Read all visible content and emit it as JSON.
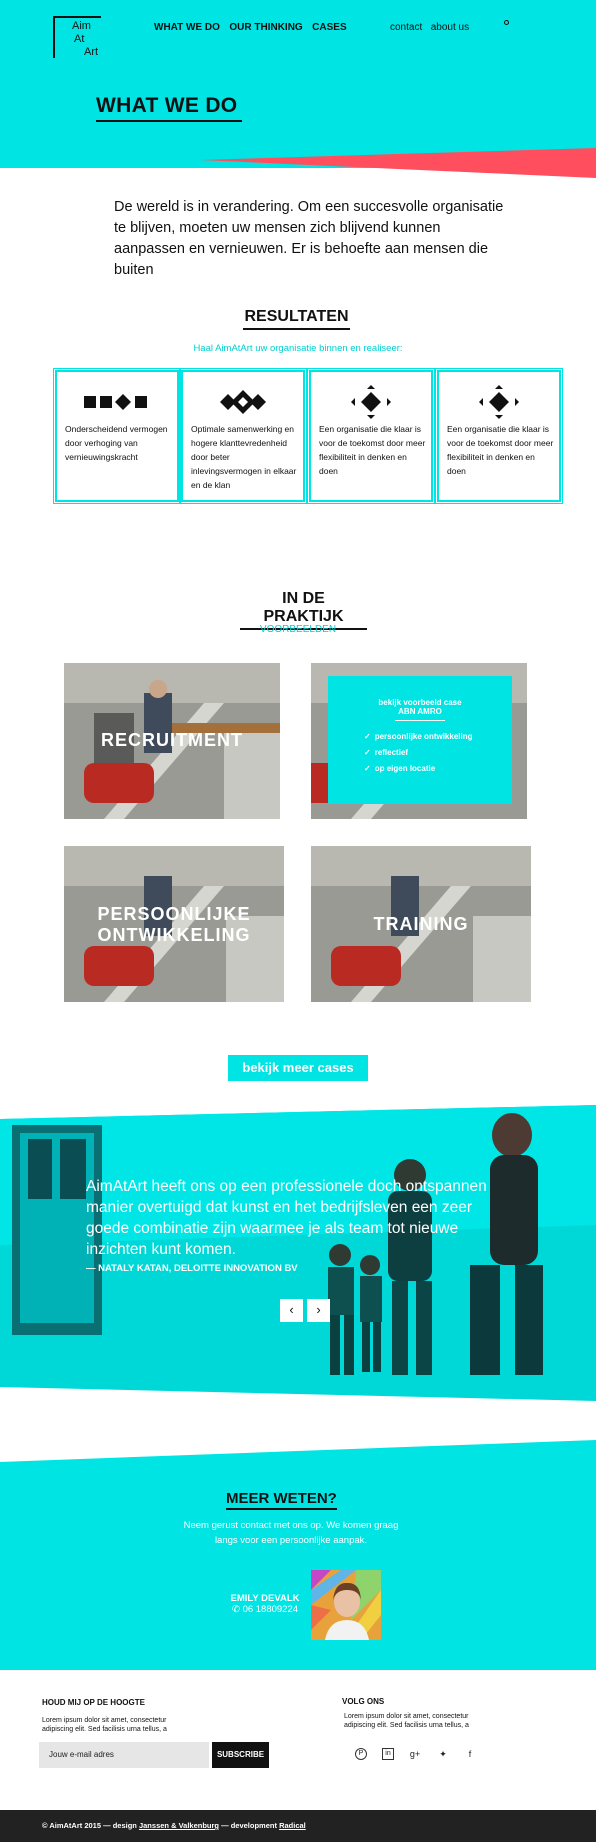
{
  "header": {
    "logo": [
      "Aim",
      "At",
      "Art"
    ],
    "nav": [
      "WHAT WE DO",
      "OUR THINKING",
      "CASES"
    ],
    "nav_right": [
      "contact",
      "about us"
    ],
    "page_title": "WHAT WE DO"
  },
  "intro": "De wereld is in verandering. Om een succesvolle organisatie te blijven, moeten uw mensen zich blijvend kunnen aanpassen en vernieuwen. Er is behoefte aan mensen die buiten",
  "results": {
    "title": "RESULTATEN",
    "subtitle": "Haal AimAtArt uw organisatie binnen en realiseer:",
    "cards": [
      "Onderscheidend vermogen door verhoging van vernieuwingskracht",
      "Optimale samenwerking en hogere klanttevredenheid door beter inlevingsvermogen in elkaar en de klan",
      "Een organisatie die klaar is voor de toekomst door meer flexibiliteit in denken en doen",
      "Een organisatie die klaar is voor de toekomst door meer flexibiliteit in denken en doen"
    ]
  },
  "practice": {
    "title": "IN DE PRAKTIJK",
    "subtitle": "VOORBEELDEN",
    "cases": [
      "RECRUITMENT",
      "PERSOONLIJKE ONTWIKKELING",
      "TRAINING"
    ],
    "panel": {
      "heading": "bekijk voorbeeld case",
      "client": "ABN AMRO",
      "items": [
        "persoonlijke ontwikkeling",
        "reflectief",
        "op eigen locatie"
      ]
    },
    "more_button": "bekijk meer cases"
  },
  "testimonial": {
    "quote": "AimAtArt heeft ons op een professionele doch ontspannen manier overtuigd dat kunst en het bedrijfsleven een zeer goede combinatie zijn waarmee je als team tot nieuwe inzichten kunt komen.",
    "author": "— NATALY KATAN, DELOITTE INNOVATION BV"
  },
  "contact": {
    "title": "MEER WETEN?",
    "text": "Neem gerust contact met ons op. We komen graag langs voor een persoonlijke aanpak.",
    "name": "EMILY DEVALK",
    "phone": "06 18809224"
  },
  "footer": {
    "newsletter_title": "HOUD MIJ OP DE HOOGTE",
    "newsletter_text": "Lorem ipsum dolor sit amet, consectetur adipiscing elit. Sed facilisis urna tellus, a",
    "email_placeholder": "Jouw e-mail adres",
    "subscribe": "SUBSCRIBE",
    "follow_title": "VOLG ONS",
    "follow_text": "Lorem ipsum dolor sit amet, consectetur adipiscing elit. Sed facilisis urna tellus, a",
    "social_icons": [
      "pinterest-icon",
      "linkedin-icon",
      "googleplus-icon",
      "twitter-icon",
      "facebook-icon"
    ],
    "copyright": "© AimAtArt 2015",
    "design_label": "design",
    "design_by": "Janssen & Valkenburg",
    "dev_label": "development",
    "dev_by": "Radical"
  },
  "colors": {
    "accent": "#00e4e4",
    "red": "#ff4f5e",
    "dark": "#222222"
  }
}
